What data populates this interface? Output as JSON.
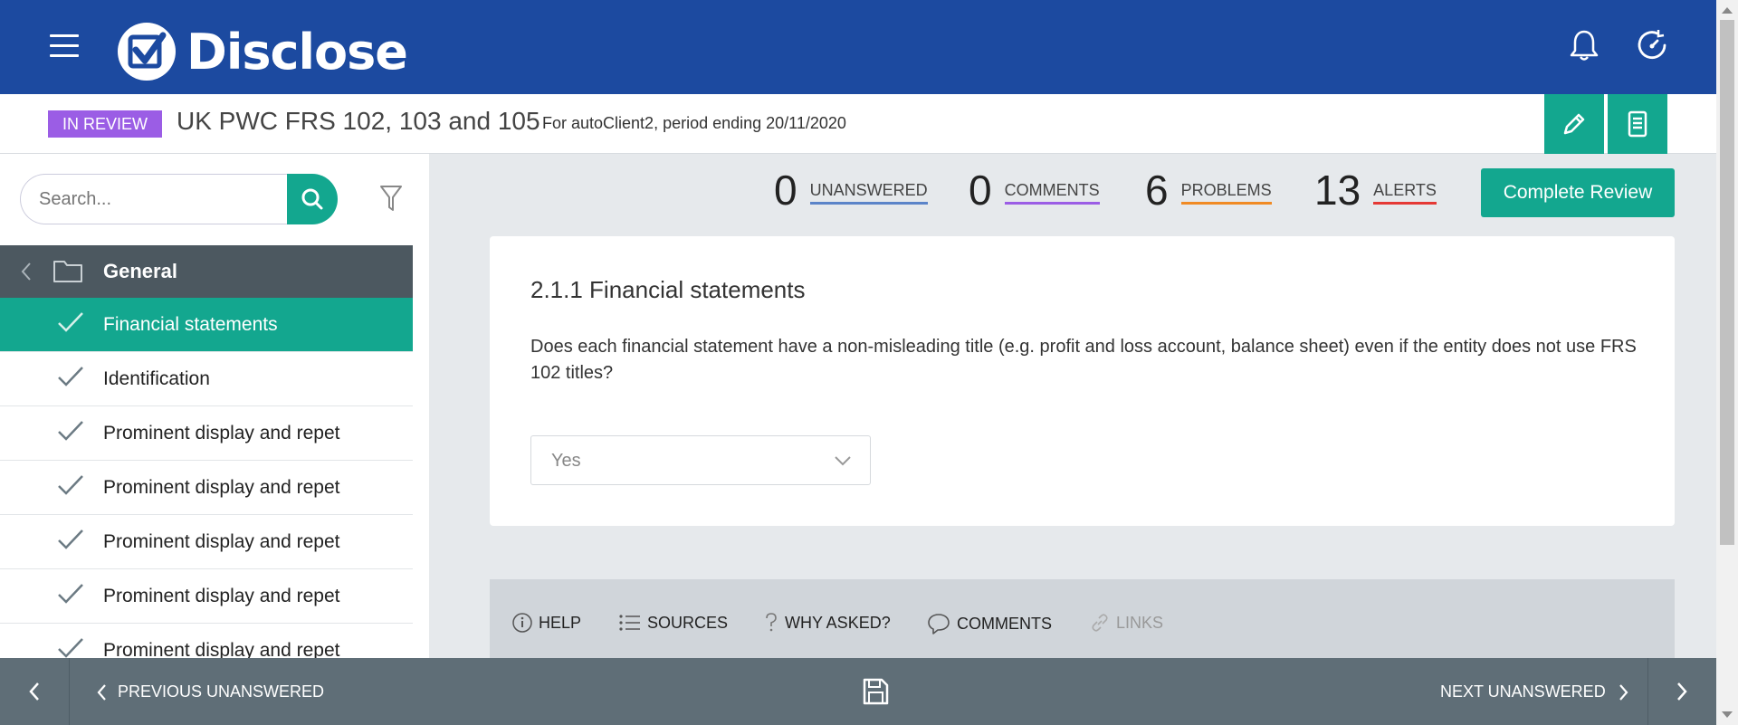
{
  "header": {
    "brand": "Disclose",
    "colors": {
      "primary": "#1c4aa0",
      "accent": "#13a78f",
      "review_badge": "#9b5de5"
    }
  },
  "subheader": {
    "status": "IN REVIEW",
    "title": "UK PWC FRS 102, 103 and 105",
    "subtitle": "For autoClient2, period ending 20/11/2020"
  },
  "sidebar": {
    "search_placeholder": "Search...",
    "folder": {
      "label": "General"
    },
    "items": [
      {
        "label": "Financial statements",
        "active": true
      },
      {
        "label": "Identification"
      },
      {
        "label": "Prominent display and repet"
      },
      {
        "label": "Prominent display and repet"
      },
      {
        "label": "Prominent display and repet"
      },
      {
        "label": "Prominent display and repet"
      },
      {
        "label": "Prominent display and repet"
      }
    ]
  },
  "stats": {
    "unanswered": {
      "count": "0",
      "label": "UNANSWERED",
      "color": "#5b84c9"
    },
    "comments": {
      "count": "0",
      "label": "COMMENTS",
      "color": "#9b5de5"
    },
    "problems": {
      "count": "6",
      "label": "PROBLEMS",
      "color": "#f08a24"
    },
    "alerts": {
      "count": "13",
      "label": "ALERTS",
      "color": "#e53935"
    }
  },
  "complete_review_label": "Complete Review",
  "question": {
    "title": "2.1.1 Financial statements",
    "text": "Does each financial statement have a non-misleading title (e.g. profit and loss account, balance sheet) even if the entity does not use FRS 102 titles?",
    "answer": "Yes"
  },
  "tabs": {
    "help": "HELP",
    "sources": "SOURCES",
    "why_asked": "WHY ASKED?",
    "comments": "COMMENTS",
    "links": "LINKS"
  },
  "footer": {
    "previous": "PREVIOUS UNANSWERED",
    "next": "NEXT UNANSWERED"
  }
}
